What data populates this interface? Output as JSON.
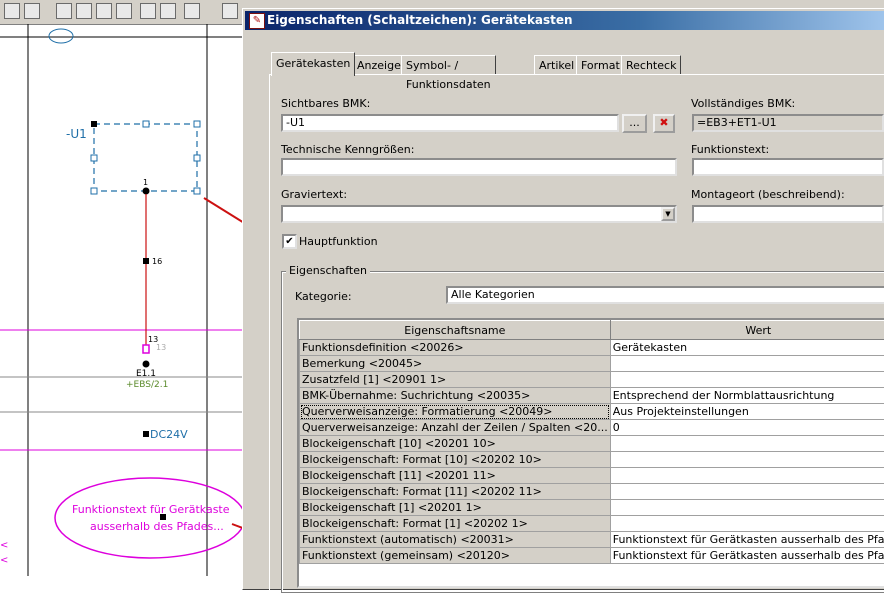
{
  "cad": {
    "bmk_label": "-U1",
    "pin_top": "1",
    "conn_label": "16",
    "pin_bottom_a": "13",
    "pin_bottom_b": "13",
    "device_label": "E1.1",
    "device_ref": "+EBS/2.1",
    "dc_label": "DC24V",
    "ellipse_line1": "Funktionstext für Gerätkaste",
    "ellipse_line2": "ausserhalb des Pfades...",
    "left_edge_glyph_1": "<",
    "left_edge_glyph_2": "<",
    "colors": {
      "blue": "#1f6fa8",
      "red": "#cc1111",
      "magenta": "#dd00dd",
      "green": "#5a8a2a"
    }
  },
  "dialog": {
    "title": "Eigenschaften (Schaltzeichen): Gerätekasten",
    "tabs": [
      "Gerätekasten",
      "Anzeige",
      "Symbol- / Funktionsdaten",
      "Artikel",
      "Format",
      "Rechteck"
    ],
    "active_tab": 0,
    "sichtbares_bmk_label": "Sichtbares BMK:",
    "sichtbares_bmk_value": "-U1",
    "browse_button": "...",
    "delete_button": "✖",
    "vollstaendiges_bmk_label": "Vollständiges BMK:",
    "vollstaendiges_bmk_value": "=EB3+ET1-U1",
    "technische_label": "Technische Kenngrößen:",
    "funktionstext_label": "Funktionstext:",
    "graviertext_label": "Graviertext:",
    "montageort_label": "Montageort (beschreibend):",
    "hauptfunktion_label": "Hauptfunktion",
    "hauptfunktion_checked": "✔",
    "eigenschaften_group": "Eigenschaften",
    "kategorie_label": "Kategorie:",
    "kategorie_value": "Alle Kategorien",
    "grid_headers": [
      "Eigenschaftsname",
      "Wert"
    ],
    "rows": [
      {
        "name": "Funktionsdefinition <20026>",
        "value": "Gerätekasten"
      },
      {
        "name": "Bemerkung <20045>",
        "value": ""
      },
      {
        "name": "Zusatzfeld [1] <20901 1>",
        "value": ""
      },
      {
        "name": "BMK-Übernahme: Suchrichtung <20035>",
        "value": "Entsprechend der Normblattausrichtung"
      },
      {
        "name": "Querverweisanzeige: Formatierung <20049>",
        "value": "Aus Projekteinstellungen"
      },
      {
        "name": "Querverweisanzeige: Anzahl der Zeilen / Spalten <20...",
        "value": "0"
      },
      {
        "name": "Blockeigenschaft [10] <20201 10>",
        "value": ""
      },
      {
        "name": "Blockeigenschaft: Format [10] <20202 10>",
        "value": ""
      },
      {
        "name": "Blockeigenschaft [11] <20201 11>",
        "value": ""
      },
      {
        "name": "Blockeigenschaft: Format [11] <20202 11>",
        "value": ""
      },
      {
        "name": "Blockeigenschaft [1] <20201 1>",
        "value": ""
      },
      {
        "name": "Blockeigenschaft: Format [1] <20202 1>",
        "value": ""
      },
      {
        "name": "Funktionstext (automatisch) <20031>",
        "value": "Funktionstext für Gerätkasten ausserhalb des Pfades"
      },
      {
        "name": "Funktionstext (gemeinsam) <20120>",
        "value": "Funktionstext für Gerätkasten ausserhalb des Pfades"
      }
    ],
    "selected_row": 4
  }
}
